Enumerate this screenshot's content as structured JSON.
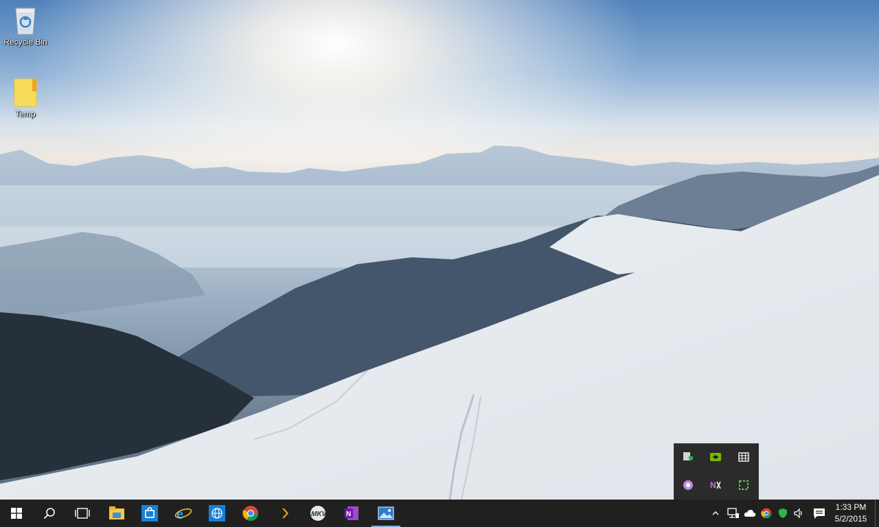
{
  "desktop": {
    "icons": [
      {
        "label": "Recycle Bin",
        "icon": "recycle-bin-icon"
      },
      {
        "label": "Temp",
        "icon": "folder-icon"
      }
    ]
  },
  "tray_overflow": {
    "icons": [
      "security-shield-icon",
      "nvidia-icon",
      "calendar-grid-icon",
      "spiral-app-icon",
      "onenote-clipper-icon",
      "green-bracket-icon"
    ]
  },
  "taskbar": {
    "pinned": [
      "start-button",
      "search-button",
      "task-view-button",
      "file-explorer-icon",
      "store-icon",
      "internet-explorer-icon",
      "globe-icon",
      "chrome-icon",
      "plex-icon",
      "mkv-icon",
      "onenote-icon",
      "photos-icon"
    ],
    "tray": [
      "show-hidden-icons-chevron",
      "network-icon",
      "onedrive-icon",
      "chrome-tray-icon",
      "shield-tray-icon",
      "volume-icon",
      "action-center-icon"
    ],
    "clock": {
      "time": "1:33 PM",
      "date": "5/2/2015"
    }
  },
  "colors": {
    "taskbar": "#202020",
    "accent": "#7ea9d6"
  }
}
